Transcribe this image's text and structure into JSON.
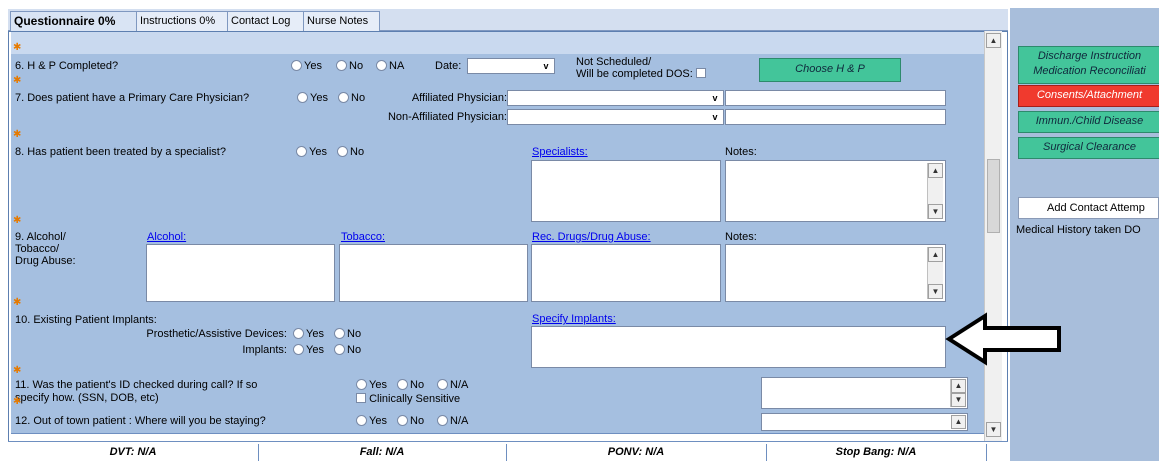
{
  "tabs": [
    {
      "label": "Questionnaire 0%"
    },
    {
      "label": "Instructions 0%"
    },
    {
      "label": "Contact Log"
    },
    {
      "label": "Nurse Notes"
    }
  ],
  "questions": {
    "q6": {
      "label": "6. H & P Completed?",
      "yes": "Yes",
      "no": "No",
      "na": "NA",
      "date_label": "Date:",
      "not_scheduled_line1": "Not Scheduled/",
      "not_scheduled_line2": "Will be completed DOS:",
      "choose_button": "Choose H & P"
    },
    "q7": {
      "label": "7. Does patient have a Primary Care Physician?",
      "yes": "Yes",
      "no": "No",
      "affiliated_label": "Affiliated Physician:",
      "non_affiliated_label": "Non-Affiliated Physician:"
    },
    "q8": {
      "label": "8. Has patient been treated by a specialist?",
      "yes": "Yes",
      "no": "No",
      "specialists_link": "Specialists:",
      "notes_label": "Notes:"
    },
    "q9": {
      "label_line1": "9. Alcohol/",
      "label_line2": "Tobacco/",
      "label_line3": "Drug Abuse:",
      "alcohol_link": "Alcohol:",
      "tobacco_link": "Tobacco:",
      "drugs_link": "Rec. Drugs/Drug Abuse:",
      "notes_label": "Notes:"
    },
    "q10": {
      "label": "10. Existing Patient Implants:",
      "prosthetic_label": "Prosthetic/Assistive Devices:",
      "implants_label": "Implants:",
      "yes": "Yes",
      "no": "No",
      "specify_link": "Specify Implants:"
    },
    "q11": {
      "label_line1": "11. Was the patient's ID checked during call? If so",
      "label_line2": "specify how. (SSN, DOB, etc)",
      "yes": "Yes",
      "no": "No",
      "na": "N/A",
      "clinically_sensitive": "Clinically Sensitive"
    },
    "q12": {
      "label": "12. Out of town patient : Where will you be staying?",
      "yes": "Yes",
      "no": "No",
      "na": "N/A"
    }
  },
  "right_panel": {
    "discharge_line1": "Discharge Instruction",
    "discharge_line2": "Medication Reconciliati",
    "consents": "Consents/Attachment",
    "immun": "Immun./Child Disease",
    "surgical": "Surgical Clearance",
    "add_contact": "Add Contact Attemp",
    "medical_history": "Medical History taken DO"
  },
  "bottom_bar": {
    "dvt": "DVT: N/A",
    "fall": "Fall: N/A",
    "ponv": "PONV: N/A",
    "stop_bang": "Stop Bang: N/A"
  },
  "colors": {
    "row_bg": "#a5bfe0",
    "accent_green": "#43c59a",
    "consents_red": "#f03a2e",
    "right_panel_bg": "#a8bedb"
  },
  "icons": [
    "arrow-left-icon",
    "required-star-icon",
    "scroll-up-icon",
    "scroll-down-icon",
    "dropdown-icon"
  ]
}
